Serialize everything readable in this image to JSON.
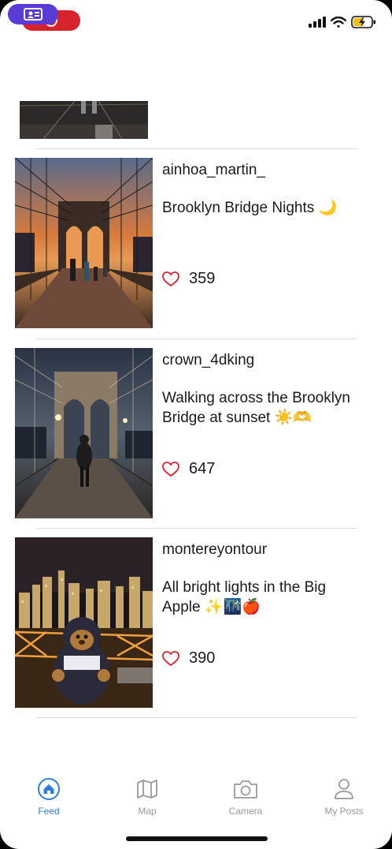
{
  "feed": {
    "posts": [
      {
        "username": "ainhoa_martin_",
        "caption": "Brooklyn Bridge Nights 🌙",
        "likes": "359"
      },
      {
        "username": "crown_4dking",
        "caption": "Walking across the Brooklyn Bridge at sunset ☀️🫶",
        "likes": "647"
      },
      {
        "username": "montereyontour",
        "caption": "All bright lights in the Big Apple ✨🌃🍎",
        "likes": "390"
      }
    ]
  },
  "tabs": [
    {
      "label": "Feed",
      "icon": "home-icon",
      "active": true
    },
    {
      "label": "Map",
      "icon": "map-icon",
      "active": false
    },
    {
      "label": "Camera",
      "icon": "camera-icon",
      "active": false
    },
    {
      "label": "My Posts",
      "icon": "person-icon",
      "active": false
    }
  ],
  "colors": {
    "accent": "#2f7fd8",
    "inactive": "#9a9a9a",
    "heart": "#d8222c",
    "recording": "#d8222c"
  }
}
